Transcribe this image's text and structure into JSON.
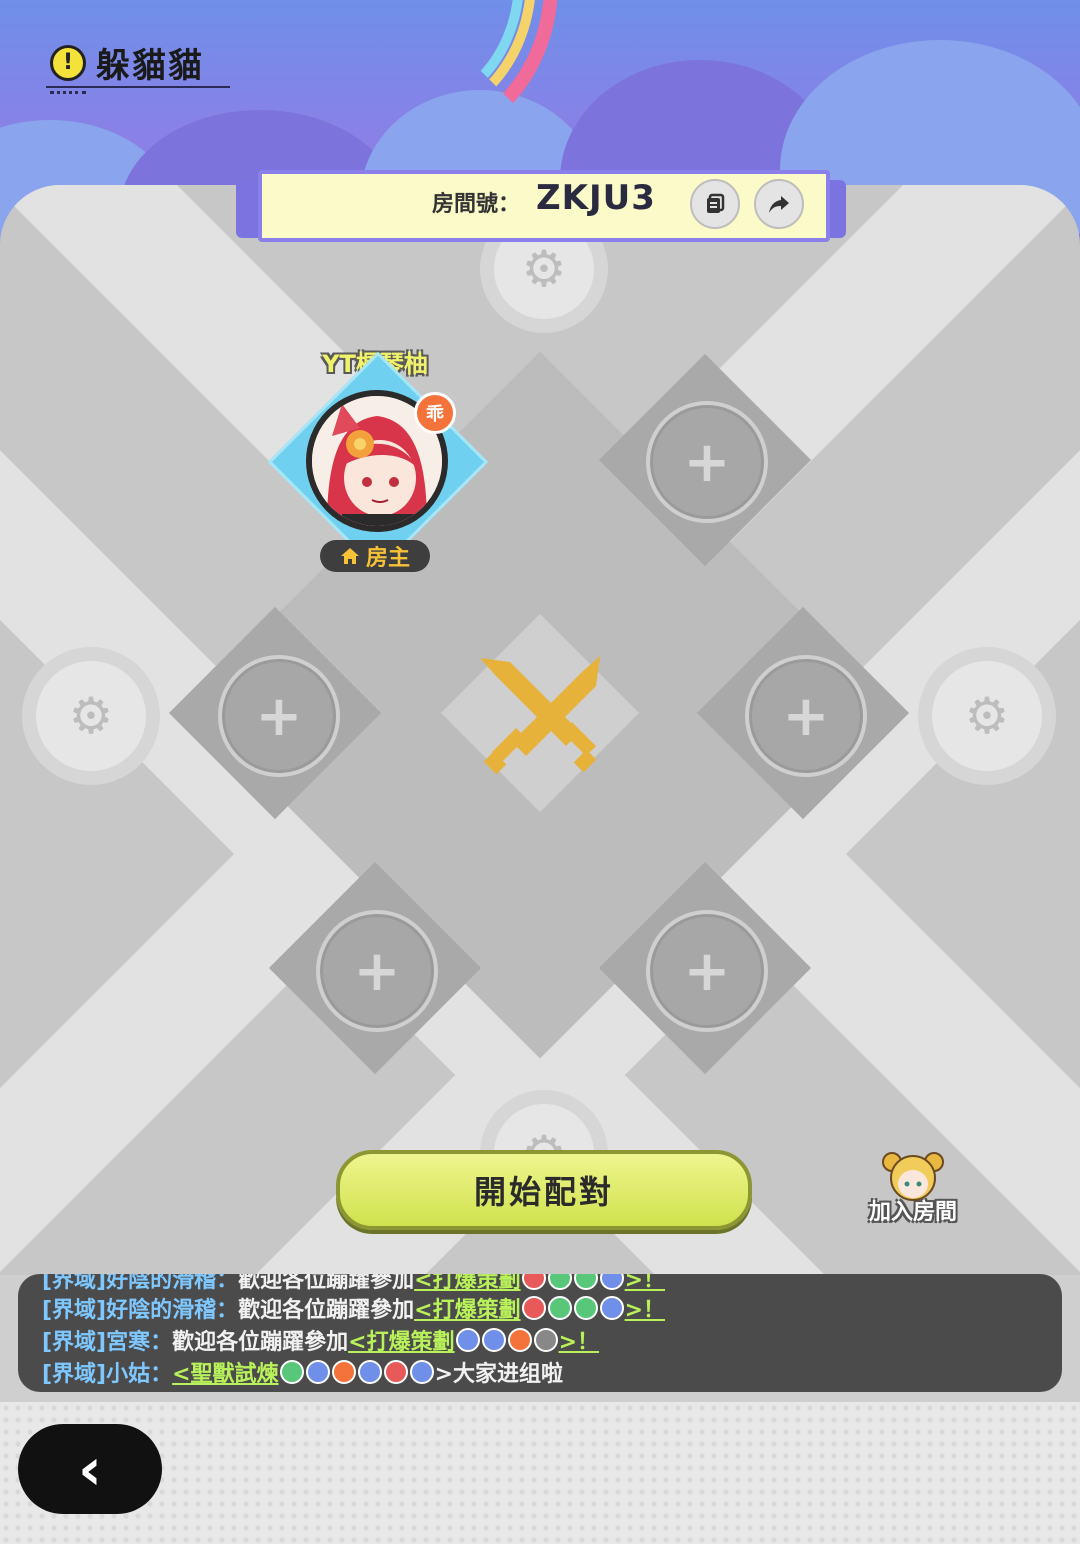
{
  "header": {
    "info_icon": "!",
    "title": "躲貓貓"
  },
  "room": {
    "label": "房間號：",
    "code": "ZKJU3",
    "copy_icon": "copy-icon",
    "share_icon": "share-icon"
  },
  "host": {
    "name": "YT楓琴柚",
    "rank_badge": "乖",
    "role_label": "房主"
  },
  "slots": {
    "add_symbol": "+"
  },
  "actions": {
    "start_match_label": "開始配對",
    "join_room_label": "加入房間"
  },
  "chat": {
    "lines": [
      {
        "channel": "[界域]好陰的滑稽：",
        "message": "歡迎各位蹦躍參加",
        "event": "<打爆策劃",
        "gems": [
          "#e85a5a",
          "#59c77a",
          "#59c77a",
          "#6f8fe8"
        ],
        "suffix": ">！"
      },
      {
        "channel": "[界域]好陰的滑稽：",
        "message": "歡迎各位蹦躍參加",
        "event": "<打爆策劃",
        "gems": [
          "#e85a5a",
          "#59c77a",
          "#59c77a",
          "#6f8fe8"
        ],
        "suffix": ">！"
      },
      {
        "channel": "[界域]宮寒：",
        "message": "歡迎各位蹦躍參加",
        "event": "<打爆策劃",
        "gems": [
          "#6f8fe8",
          "#6f8fe8",
          "#f3733a",
          "#888888"
        ],
        "suffix": ">！"
      },
      {
        "channel": "[界域]小姑：",
        "message": "",
        "event": "<聖獸試煉",
        "gems": [
          "#59c77a",
          "#6f8fe8",
          "#f3733a",
          "#6f8fe8",
          "#e85a5a",
          "#6f8fe8"
        ],
        "suffix": ">大家进组啦"
      }
    ]
  },
  "footer": {
    "back_label": "‹"
  },
  "colors": {
    "accent_purple": "#7b73e0",
    "start_button": "#cfe24d",
    "host_tile": "#6fd0ef",
    "rank_orange": "#f3733a"
  }
}
